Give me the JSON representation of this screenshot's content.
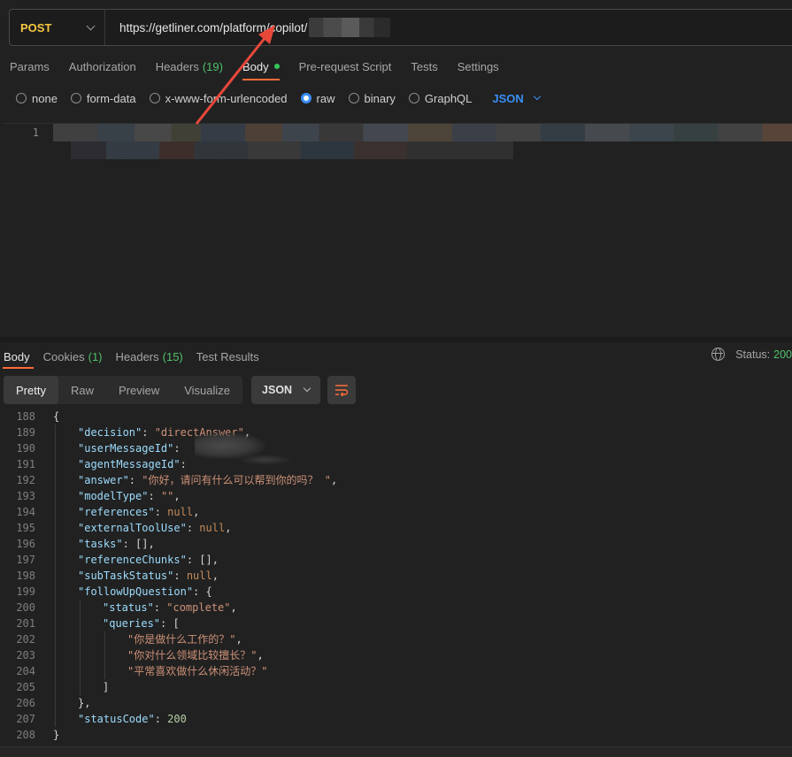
{
  "request": {
    "method": "POST",
    "url": "https://getliner.com/platform/copilot/"
  },
  "req_tabs": [
    {
      "label": "Params"
    },
    {
      "label": "Authorization"
    },
    {
      "label": "Headers",
      "count": "(19)"
    },
    {
      "label": "Body"
    },
    {
      "label": "Pre-request Script"
    },
    {
      "label": "Tests"
    },
    {
      "label": "Settings"
    }
  ],
  "body_types": {
    "none": "none",
    "form_data": "form-data",
    "urlencoded": "x-www-form-urlencoded",
    "raw": "raw",
    "binary": "binary",
    "graphql": "GraphQL",
    "format": "JSON",
    "selected": "raw"
  },
  "editor": {
    "line": "1"
  },
  "resp_tabs": [
    {
      "label": "Body"
    },
    {
      "label": "Cookies",
      "count": "(1)"
    },
    {
      "label": "Headers",
      "count": "(15)"
    },
    {
      "label": "Test Results"
    }
  ],
  "status": {
    "label": "Status:",
    "value": "200"
  },
  "view_modes": [
    "Pretty",
    "Raw",
    "Preview",
    "Visualize"
  ],
  "response_format": "JSON",
  "response_lines": [
    {
      "n": "188",
      "indent": 0,
      "text": "{"
    },
    {
      "n": "189",
      "indent": 1,
      "key": "decision",
      "value": "directAnswer",
      "type": "string"
    },
    {
      "n": "190",
      "indent": 1,
      "key": "userMessageId",
      "value": "",
      "type": "masked"
    },
    {
      "n": "191",
      "indent": 1,
      "key": "agentMessageId",
      "value": "",
      "type": "masked"
    },
    {
      "n": "192",
      "indent": 1,
      "key": "answer",
      "value": "你好，请问有什么可以帮到你的吗？ ",
      "type": "string"
    },
    {
      "n": "193",
      "indent": 1,
      "key": "modelType",
      "value": "",
      "type": "string"
    },
    {
      "n": "194",
      "indent": 1,
      "key": "references",
      "value": "null",
      "type": "null"
    },
    {
      "n": "195",
      "indent": 1,
      "key": "externalToolUse",
      "value": "null",
      "type": "null"
    },
    {
      "n": "196",
      "indent": 1,
      "key": "tasks",
      "value": "[]",
      "type": "punct"
    },
    {
      "n": "197",
      "indent": 1,
      "key": "referenceChunks",
      "value": "[]",
      "type": "punct"
    },
    {
      "n": "198",
      "indent": 1,
      "key": "subTaskStatus",
      "value": "null",
      "type": "null"
    },
    {
      "n": "199",
      "indent": 1,
      "key": "followUpQuestion",
      "value": "{",
      "type": "open"
    },
    {
      "n": "200",
      "indent": 2,
      "key": "status",
      "value": "complete",
      "type": "string"
    },
    {
      "n": "201",
      "indent": 2,
      "key": "queries",
      "value": "[",
      "type": "open"
    },
    {
      "n": "202",
      "indent": 3,
      "value": "你是做什么工作的？",
      "type": "item"
    },
    {
      "n": "203",
      "indent": 3,
      "value": "你对什么领域比较擅长？",
      "type": "item"
    },
    {
      "n": "204",
      "indent": 3,
      "value": "平常喜欢做什么休闲活动？",
      "type": "itemlast"
    },
    {
      "n": "205",
      "indent": 2,
      "text": "]"
    },
    {
      "n": "206",
      "indent": 1,
      "text": "},"
    },
    {
      "n": "207",
      "indent": 1,
      "key": "statusCode",
      "value": "200",
      "type": "number"
    },
    {
      "n": "208",
      "indent": 0,
      "text": "}"
    }
  ],
  "colors": {
    "accent": "#ff6c37",
    "method": "#f5c842",
    "count": "#4fc06a",
    "radio": "#3a8ff5",
    "arrow": "#e8483a"
  }
}
